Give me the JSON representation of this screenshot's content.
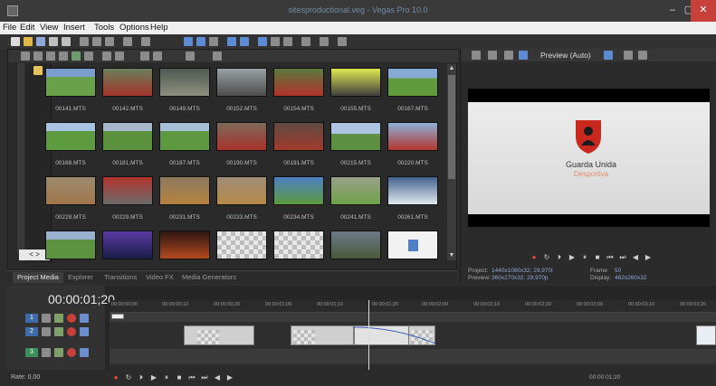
{
  "window": {
    "title": "sitesproductional.veg - Vegas Pro 10.0"
  },
  "menu": [
    "File",
    "Edit",
    "View",
    "Insert",
    "Tools",
    "Options",
    "Help"
  ],
  "media": {
    "clips": [
      "00141.MTS",
      "00142.MTS",
      "00149.MTS",
      "00152.MTS",
      "00154.MTS",
      "00155.MTS",
      "00167.MTS",
      "00168.MTS",
      "00181.MTS",
      "00187.MTS",
      "00190.MTS",
      "00191.MTS",
      "00215.MTS",
      "00220.MTS",
      "00228.MTS",
      "00229.MTS",
      "00231.MTS",
      "00233.MTS",
      "00234.MTS",
      "00241.MTS",
      "00261.MTS"
    ],
    "nav_arrows": "< >"
  },
  "tabs": [
    "Project Media",
    "Explorer",
    "Transitions",
    "Video FX",
    "Media Generators"
  ],
  "preview": {
    "label": "Preview (Auto)",
    "logo_title": "Guarda Unida",
    "logo_subtitle": "Desportiva",
    "project_label": "Project:",
    "project_value": "1440x1080x32; 29,970i",
    "preview_label": "Preview:",
    "preview_value": "360x270x32; 29,970p",
    "frame_label": "Frame:",
    "frame_value": "50",
    "display_label": "Display:",
    "display_value": "462x260x32"
  },
  "timeline": {
    "timecode": "00:00:01;20",
    "ruler": [
      "00:00:00;00",
      "00:00:00;10",
      "00:00:00;20",
      "00:00:01;00",
      "00:00:01;10",
      "00:00:01;20",
      "00:00:02;00",
      "00:00:02;10",
      "00:00:02;20",
      "00:00:03;00",
      "00:00:03;10",
      "00:00:03;20"
    ],
    "tracks": [
      "1",
      "2",
      "3"
    ],
    "rate": "Rate: 0,00",
    "end_timecode": "00:00:01;20"
  },
  "colors": {
    "shield_red": "#c8281e",
    "accent_blue": "#3e6ca8"
  }
}
